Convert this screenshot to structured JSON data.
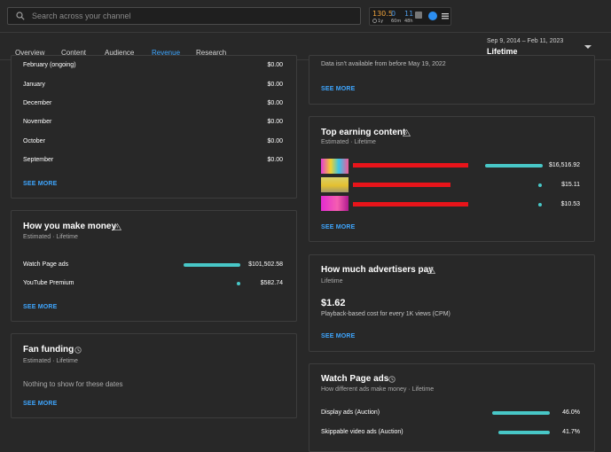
{
  "search": {
    "placeholder": "Search across your channel"
  },
  "stats_widget": {
    "a_value": "130.5",
    "a_unit": "1y",
    "b_value": "0",
    "b_unit": "60m",
    "c_value": "11",
    "c_unit": "48h"
  },
  "tabs": [
    {
      "label": "Overview"
    },
    {
      "label": "Content"
    },
    {
      "label": "Audience"
    },
    {
      "label": "Revenue"
    },
    {
      "label": "Research"
    }
  ],
  "active_tab": "Revenue",
  "date_range": {
    "range": "Sep 9, 2014 – Feb 11, 2023",
    "label": "Lifetime"
  },
  "monthly": {
    "rows": [
      {
        "month": "February (ongoing)",
        "amount": "$0.00"
      },
      {
        "month": "January",
        "amount": "$0.00"
      },
      {
        "month": "December",
        "amount": "$0.00"
      },
      {
        "month": "November",
        "amount": "$0.00"
      },
      {
        "month": "October",
        "amount": "$0.00"
      },
      {
        "month": "September",
        "amount": "$0.00"
      }
    ],
    "see_more": "SEE MORE"
  },
  "data_note": {
    "text": "Data isn't available from before May 19, 2022",
    "see_more": "SEE MORE"
  },
  "top_earning": {
    "title": "Top earning content",
    "subtitle": "Estimated · Lifetime",
    "items": [
      {
        "amount": "$16,516.92",
        "fraction": 1.0
      },
      {
        "amount": "$15.11",
        "fraction": 0.001
      },
      {
        "amount": "$10.53",
        "fraction": 0.001
      }
    ],
    "see_more": "SEE MORE"
  },
  "how_make_money": {
    "title": "How you make money",
    "subtitle": "Estimated · Lifetime",
    "rows": [
      {
        "label": "Watch Page ads",
        "amount": "$101,502.58",
        "fraction": 1.0
      },
      {
        "label": "YouTube Premium",
        "amount": "$582.74",
        "fraction": 0.006
      }
    ],
    "see_more": "SEE MORE"
  },
  "advertisers_pay": {
    "title": "How much advertisers pay",
    "subtitle": "Lifetime",
    "value": "$1.62",
    "caption": "Playback-based cost for every 1K views (CPM)",
    "see_more": "SEE MORE"
  },
  "fan_funding": {
    "title": "Fan funding",
    "subtitle": "Estimated · Lifetime",
    "empty": "Nothing to show for these dates",
    "see_more": "SEE MORE"
  },
  "watch_page_ads": {
    "title": "Watch Page ads",
    "subtitle": "How different ads make money · Lifetime",
    "rows": [
      {
        "label": "Display ads (Auction)",
        "percent": "46.0%",
        "fraction": 0.46
      },
      {
        "label": "Skippable video ads (Auction)",
        "percent": "41.7%",
        "fraction": 0.417
      }
    ]
  },
  "colors": {
    "accent": "#3ea6ff",
    "bar": "#48c7c7",
    "background": "#282828"
  }
}
